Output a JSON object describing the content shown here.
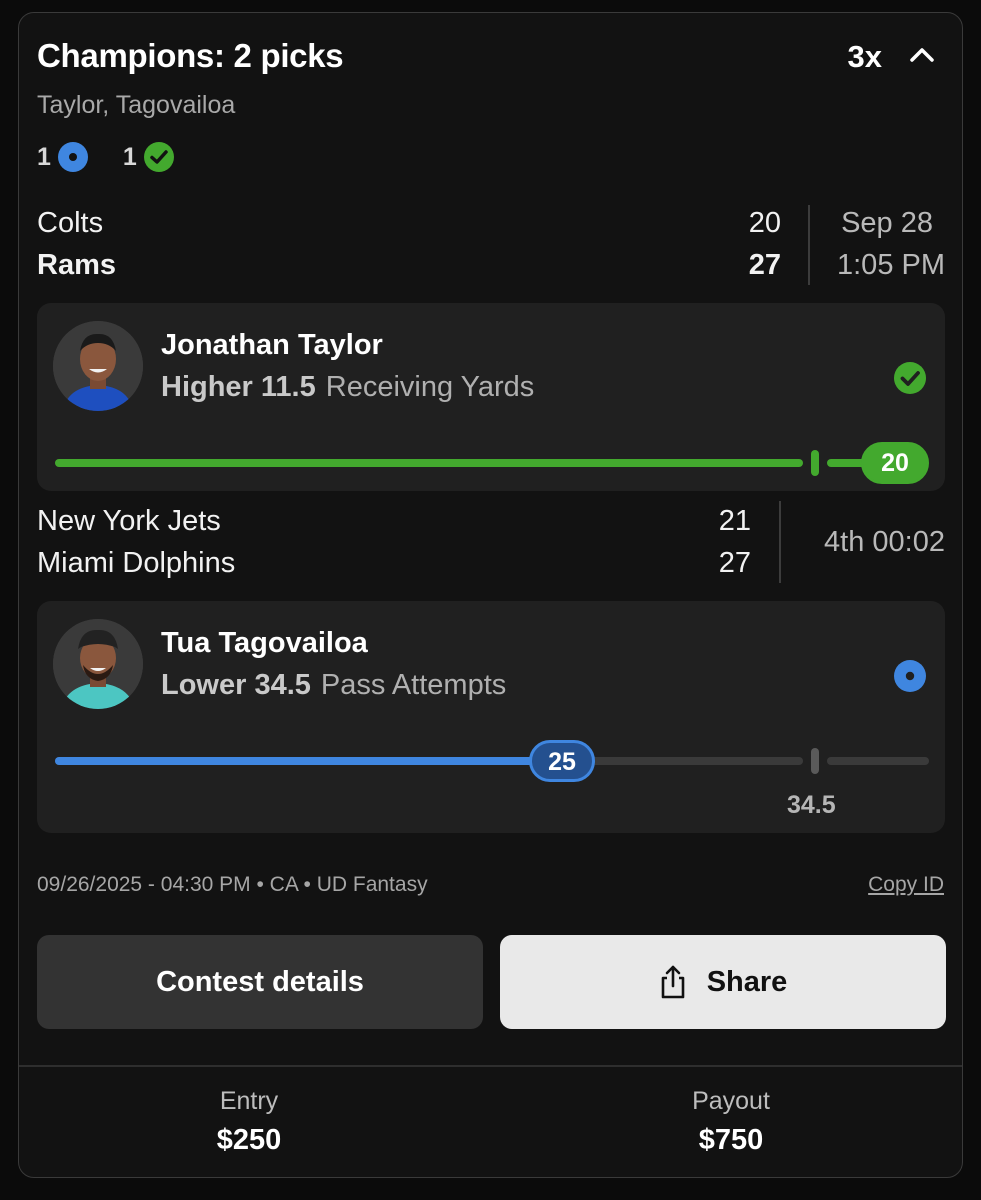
{
  "header": {
    "title": "Champions: 2 picks",
    "multiplier": "3x",
    "subtitle": "Taylor, Tagovailoa",
    "pending_count": "1",
    "won_count": "1"
  },
  "games": [
    {
      "team1": "Colts",
      "score1": "20",
      "team2": "Rams",
      "score2": "27",
      "time_line1": "Sep 28",
      "time_line2": "1:05 PM"
    },
    {
      "team1": "New York Jets",
      "score1": "21",
      "team2": "Miami Dolphins",
      "score2": "27",
      "status": "4th 00:02"
    }
  ],
  "picks": [
    {
      "player": "Jonathan Taylor",
      "direction": "Higher 11.5",
      "stat": "Receiving Yards",
      "current_value": "20",
      "line": 11.5,
      "result": "won",
      "accent": "#43a92e"
    },
    {
      "player": "Tua Tagovailoa",
      "direction": "Lower 34.5",
      "stat": "Pass Attempts",
      "current_value": "25",
      "line_label": "34.5",
      "line": 34.5,
      "result": "pending",
      "accent": "#3f86e0"
    }
  ],
  "meta": {
    "timestamp": "09/26/2025 - 04:30 PM • CA • UD Fantasy",
    "copy_id": "Copy ID"
  },
  "actions": {
    "contest_details": "Contest details",
    "share": "Share"
  },
  "footer": {
    "entry_label": "Entry",
    "entry_value": "$250",
    "payout_label": "Payout",
    "payout_value": "$750"
  },
  "colors": {
    "background": "#121212",
    "panel": "#202020",
    "won_green": "#43a92e",
    "pending_blue": "#3f86e0"
  }
}
